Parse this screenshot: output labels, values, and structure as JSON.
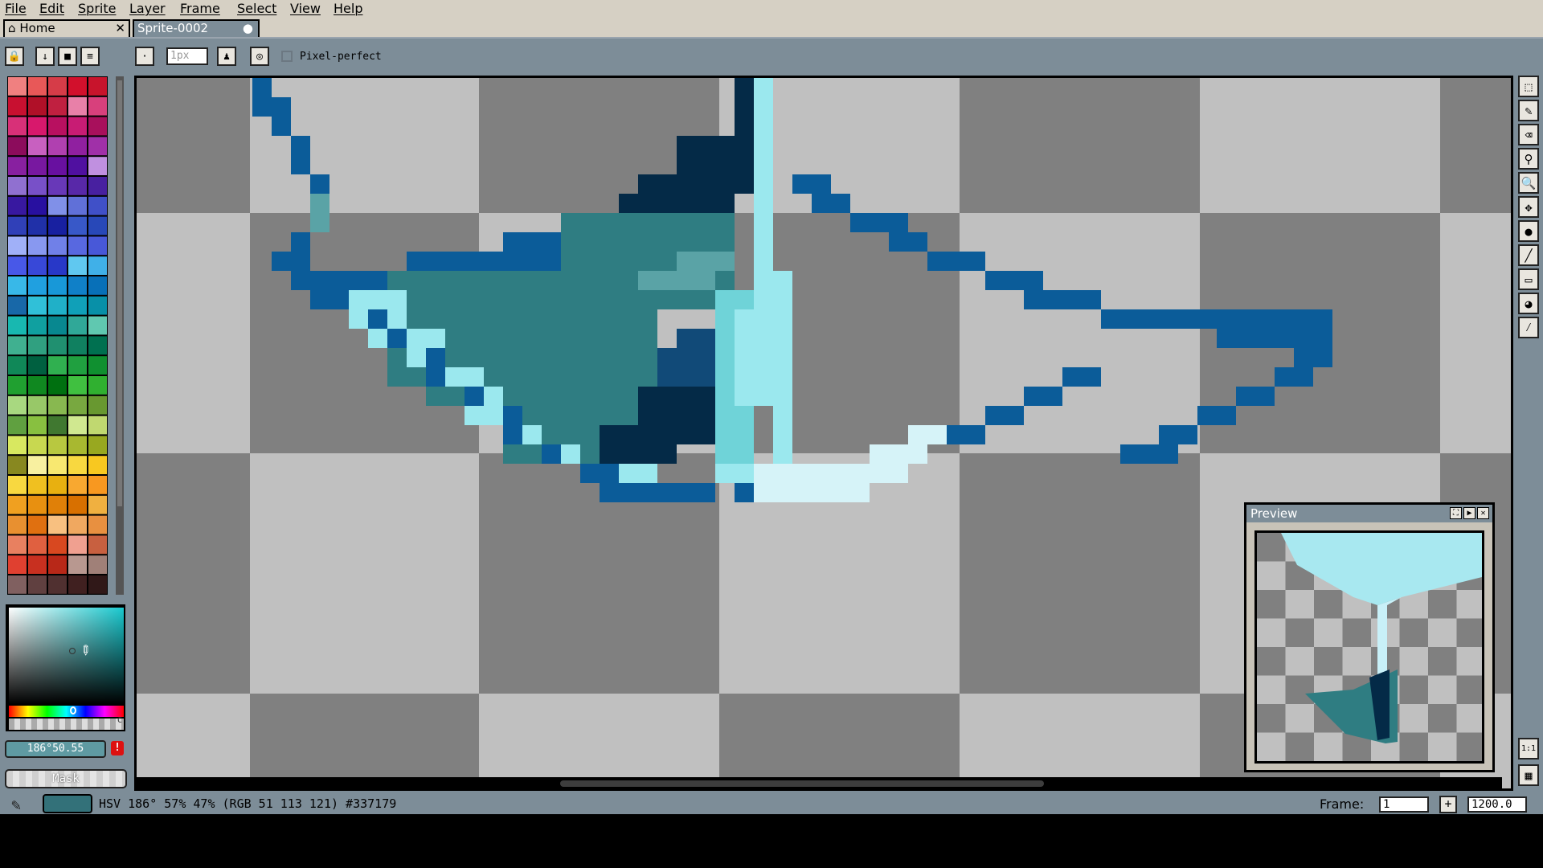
{
  "menu": {
    "file": "File",
    "edit": "Edit",
    "sprite": "Sprite",
    "layer": "Layer",
    "frame": "Frame",
    "select": "Select",
    "view": "View",
    "help": "Help"
  },
  "tabs": {
    "home": "Home",
    "sprite": "Sprite-0002"
  },
  "tool_options": {
    "brush_size": "1px",
    "pixel_perfect": "Pixel-perfect"
  },
  "color_picker": {
    "hue": "186",
    "hsv_field": "186°50.55",
    "hue_bar_label": "C"
  },
  "mask_label": "Mask",
  "preview": {
    "title": "Preview"
  },
  "status": {
    "text": "HSV 186° 57% 47% (RGB 51 113 121) #337179",
    "swatch_color": "#337179",
    "frame_label": "Frame:",
    "frame_value": "1",
    "zoom_value": "1200.0",
    "one_to_one": "1:1"
  },
  "colors": {
    "accent": "#337179",
    "outline": "#0b5c99",
    "dark": "#042a47",
    "ice": "#9be8ee",
    "teal": "#2f7d82"
  },
  "icons": {
    "pin_lock": "lock-icon",
    "tools": [
      "rectangle-marquee-icon",
      "pencil-icon",
      "eraser-icon",
      "eyedropper-icon",
      "zoom-icon",
      "move-icon",
      "paint-bucket-icon",
      "line-icon",
      "rectangle-icon",
      "blur-icon",
      "spray-icon"
    ]
  }
}
